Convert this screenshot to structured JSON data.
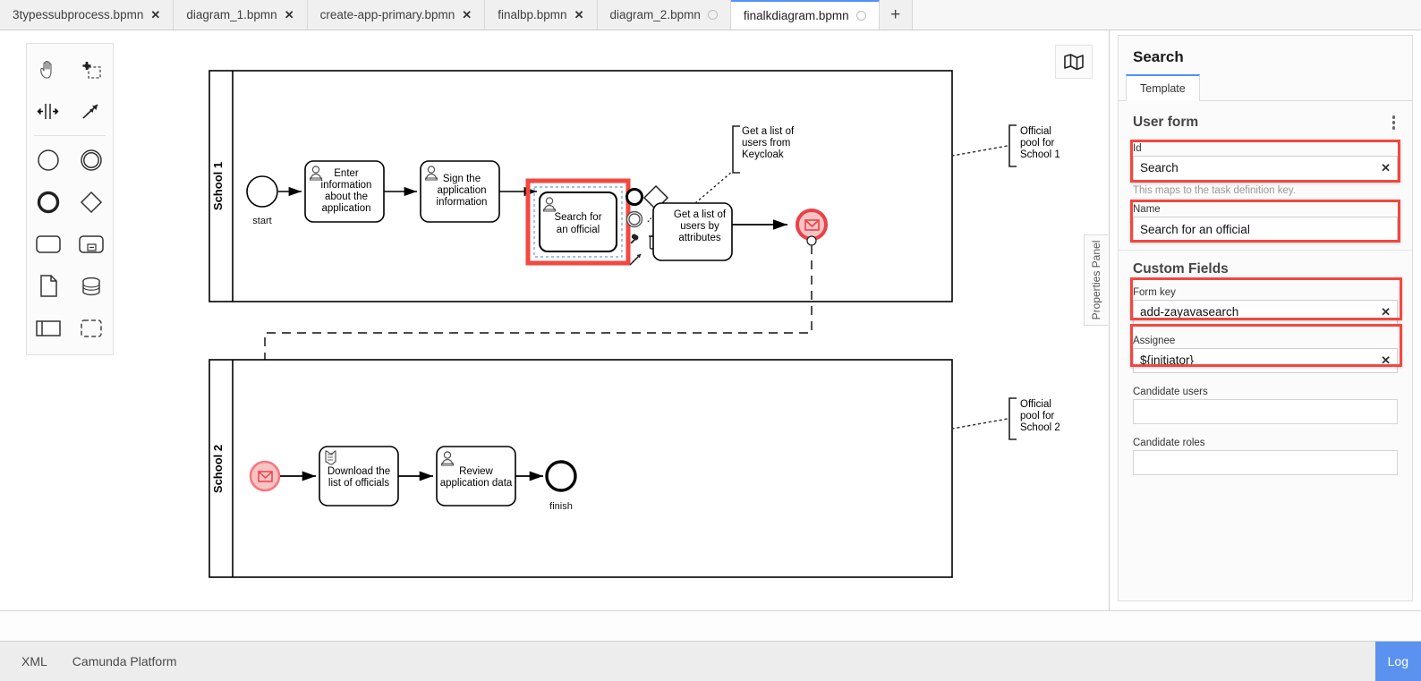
{
  "app": {
    "name": "Camunda Modeler"
  },
  "tabs": [
    {
      "label": "3typessubprocess.bpmn",
      "close": "✕",
      "active": false,
      "dirty": false
    },
    {
      "label": "diagram_1.bpmn",
      "close": "✕",
      "active": false,
      "dirty": false
    },
    {
      "label": "create-app-primary.bpmn",
      "close": "✕",
      "active": false,
      "dirty": false
    },
    {
      "label": "finalbp.bpmn",
      "close": "✕",
      "active": false,
      "dirty": false
    },
    {
      "label": "diagram_2.bpmn",
      "close": "",
      "active": false,
      "dirty": true
    },
    {
      "label": "finalkdiagram.bpmn",
      "close": "",
      "active": true,
      "dirty": true
    }
  ],
  "tab_add_label": "+",
  "palette": {
    "items": [
      {
        "name": "hand-tool",
        "title": "Activate the hand tool"
      },
      {
        "name": "lasso-tool",
        "title": "Activate the lasso tool"
      },
      {
        "name": "space-tool",
        "title": "Activate the create/remove space tool"
      },
      {
        "name": "global-connect-tool",
        "title": "Activate the global connect tool"
      },
      {
        "name": "start-event",
        "title": "Create StartEvent"
      },
      {
        "name": "intermediate-event",
        "title": "Create Intermediate/Boundary Event"
      },
      {
        "name": "end-event",
        "title": "Create EndEvent"
      },
      {
        "name": "gateway",
        "title": "Create Gateway"
      },
      {
        "name": "task",
        "title": "Create Task"
      },
      {
        "name": "subprocess-expanded",
        "title": "Create expanded SubProcess"
      },
      {
        "name": "data-object",
        "title": "Create DataObjectReference"
      },
      {
        "name": "data-store",
        "title": "Create DataStoreReference"
      },
      {
        "name": "participant",
        "title": "Create Pool/Participant"
      },
      {
        "name": "group",
        "title": "Create Group"
      }
    ]
  },
  "canvas": {
    "minimap_icon": "map-icon",
    "pools": [
      {
        "label": "School 1",
        "annotation": [
          "Official",
          "pool for",
          "School 1"
        ]
      },
      {
        "label": "School 2",
        "annotation": [
          "Official",
          "pool for",
          "School 2"
        ]
      }
    ],
    "pool1_nodes": [
      {
        "type": "start-event",
        "label": "start"
      },
      {
        "type": "user-task",
        "label": [
          "Enter",
          "information",
          "about the",
          "application"
        ]
      },
      {
        "type": "user-task",
        "label": [
          "Sign the",
          "application",
          "information"
        ]
      },
      {
        "type": "user-task",
        "label": [
          "Search for",
          "an official"
        ],
        "selected": true,
        "highlighted": true
      },
      {
        "type": "service-task",
        "label": [
          "Get a list of",
          "users by",
          "attributes"
        ]
      },
      {
        "type": "message-end-event",
        "label": "",
        "highlighted": true
      }
    ],
    "pool1_annotations": [
      {
        "lines": [
          "Get a list of",
          "users from",
          "Keycloak"
        ]
      }
    ],
    "pool2_nodes": [
      {
        "type": "message-start-event",
        "label": "",
        "highlighted": true
      },
      {
        "type": "script-task",
        "label": [
          "Download the",
          "list of officials"
        ]
      },
      {
        "type": "user-task",
        "label": [
          "Review",
          "application data"
        ]
      },
      {
        "type": "end-event",
        "label": "finish"
      }
    ],
    "context_pad": [
      {
        "name": "append-end-event-icon"
      },
      {
        "name": "append-intermediate-event-icon"
      },
      {
        "name": "append-gateway-icon"
      },
      {
        "name": "append-task-icon"
      },
      {
        "name": "wrench-icon"
      },
      {
        "name": "append-text-annotation-icon"
      },
      {
        "name": "trash-icon"
      },
      {
        "name": "connect-icon"
      }
    ]
  },
  "properties_panel_tab": {
    "label": "Properties Panel"
  },
  "panel": {
    "title": "Search",
    "tabs": [
      {
        "label": "Template",
        "active": true
      }
    ],
    "groups": [
      {
        "title": "User form",
        "menu_icon": "kebab-icon",
        "fields": [
          {
            "label": "Id",
            "value": "Search",
            "placeholder": "",
            "clear": "✕",
            "hint": "This maps to the task definition key.",
            "highlighted": true,
            "kind": "input"
          },
          {
            "label": "Name",
            "value": "Search for an official",
            "placeholder": "",
            "clear": "",
            "hint": "",
            "highlighted": true,
            "kind": "textarea"
          }
        ]
      },
      {
        "title": "Custom Fields",
        "menu_icon": "",
        "fields": [
          {
            "label": "Form key",
            "value": "add-zayavasearch",
            "placeholder": "",
            "clear": "✕",
            "hint": "",
            "highlighted": true,
            "kind": "input"
          },
          {
            "label": "Assignee",
            "value": "${initiator}",
            "placeholder": "",
            "clear": "✕",
            "hint": "",
            "highlighted": true,
            "kind": "input"
          },
          {
            "label": "Candidate users",
            "value": "",
            "placeholder": "",
            "clear": "",
            "hint": "",
            "highlighted": false,
            "kind": "input"
          },
          {
            "label": "Candidate roles",
            "value": "",
            "placeholder": "",
            "clear": "",
            "hint": "",
            "highlighted": false,
            "kind": "input"
          }
        ]
      }
    ]
  },
  "statusbar": {
    "items": [
      "XML",
      "Camunda Platform"
    ],
    "log_label": "Log",
    "log_color": "#5b92f0"
  },
  "colors": {
    "accent": "#4d90ff",
    "highlight_red": "#f4473f",
    "message_red": "#e8424a",
    "message_fill": "#f9c3c3"
  }
}
